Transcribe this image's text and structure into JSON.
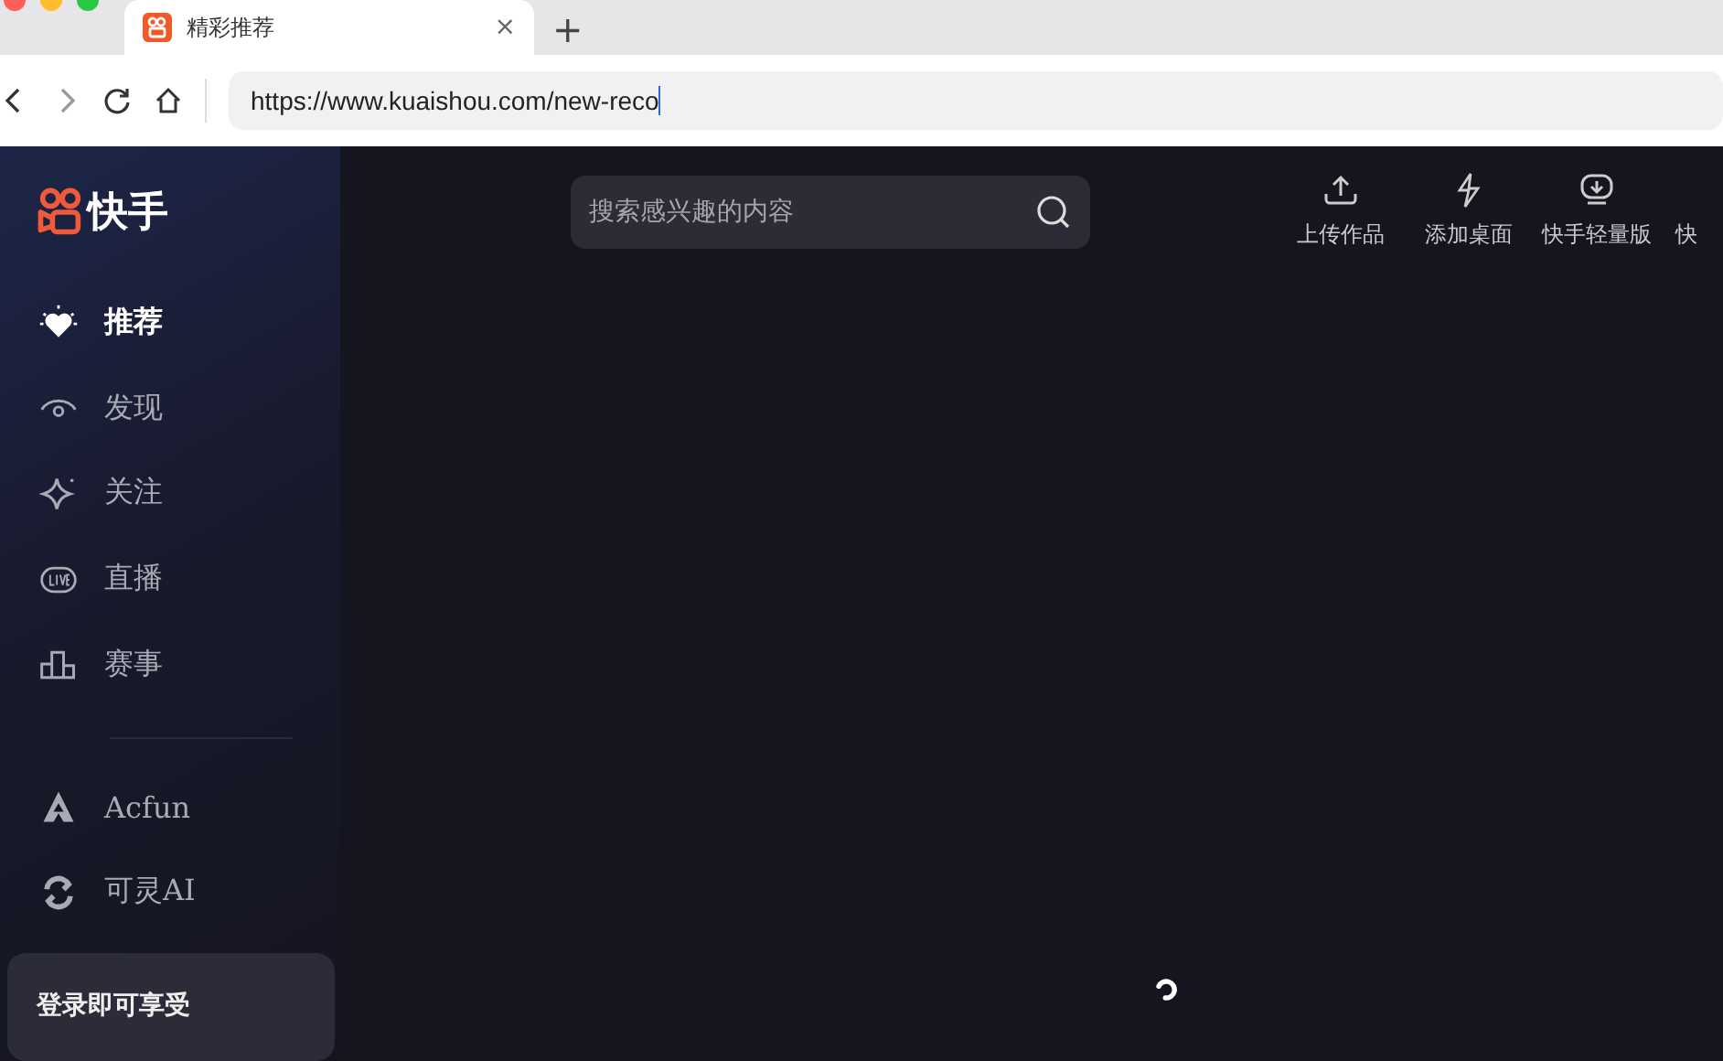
{
  "browser": {
    "tab": {
      "title": "精彩推荐",
      "close": "×",
      "selected": true
    },
    "new_tab": "+",
    "address": {
      "value": "https://www.kuaishou.com/new-reco"
    }
  },
  "sidebar": {
    "logo": "快手",
    "nav": [
      {
        "label": "推荐",
        "selected": true
      },
      {
        "label": "发现",
        "selected": false
      },
      {
        "label": "关注",
        "selected": false
      },
      {
        "label": "直播",
        "selected": false
      },
      {
        "label": "赛事",
        "selected": false
      }
    ],
    "apps": [
      {
        "label": "Acfun"
      },
      {
        "label": "可灵AI"
      }
    ],
    "login_card": {
      "text": "登录即可享受"
    }
  },
  "search": {
    "placeholder": "搜索感兴趣的内容"
  },
  "toolbar": [
    {
      "label": "上传作品"
    },
    {
      "label": "添加桌面"
    },
    {
      "label": "快手轻量版"
    },
    {
      "label": "快"
    }
  ]
}
